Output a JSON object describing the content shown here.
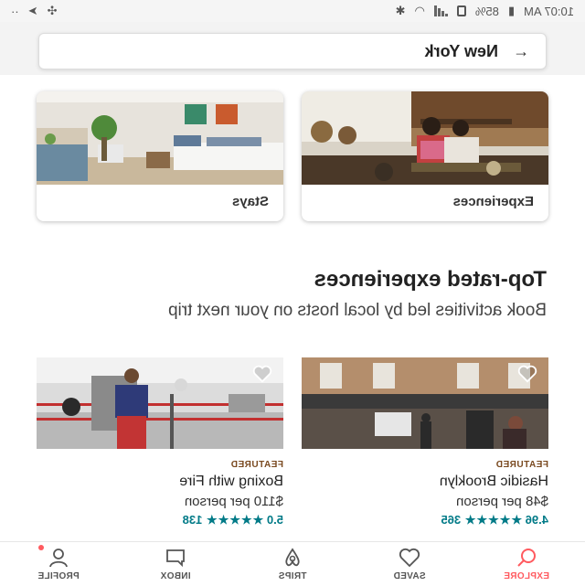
{
  "status_bar": {
    "time": "10:07 AM",
    "battery": "85%"
  },
  "search": {
    "location": "New York"
  },
  "categories": [
    {
      "label": "Stays"
    },
    {
      "label": "Experiences"
    }
  ],
  "section": {
    "title": "Top-rated experiences",
    "subtitle": "Book activities led by local hosts on your next trip"
  },
  "experiences": [
    {
      "tag": "FEATURED",
      "title": "Boxing with Fire",
      "price": "$110 per person",
      "rating": "5.0",
      "stars": "★★★★★",
      "reviews": "138"
    },
    {
      "tag": "FEATURED",
      "title": "Hasidic Brooklyn",
      "price": "$48 per person",
      "rating": "4.96",
      "stars": "★★★★★",
      "reviews": "365"
    }
  ],
  "nav": [
    {
      "label": "EXPLORE",
      "icon": "search-icon",
      "active": true
    },
    {
      "label": "SAVED",
      "icon": "heart-icon"
    },
    {
      "label": "TRIPS",
      "icon": "trips-icon"
    },
    {
      "label": "INBOX",
      "icon": "inbox-icon"
    },
    {
      "label": "PROFILE",
      "icon": "profile-icon"
    }
  ],
  "colors": {
    "accent": "#ff5a5f",
    "rating": "#007a87",
    "featured": "#7a4a20"
  }
}
